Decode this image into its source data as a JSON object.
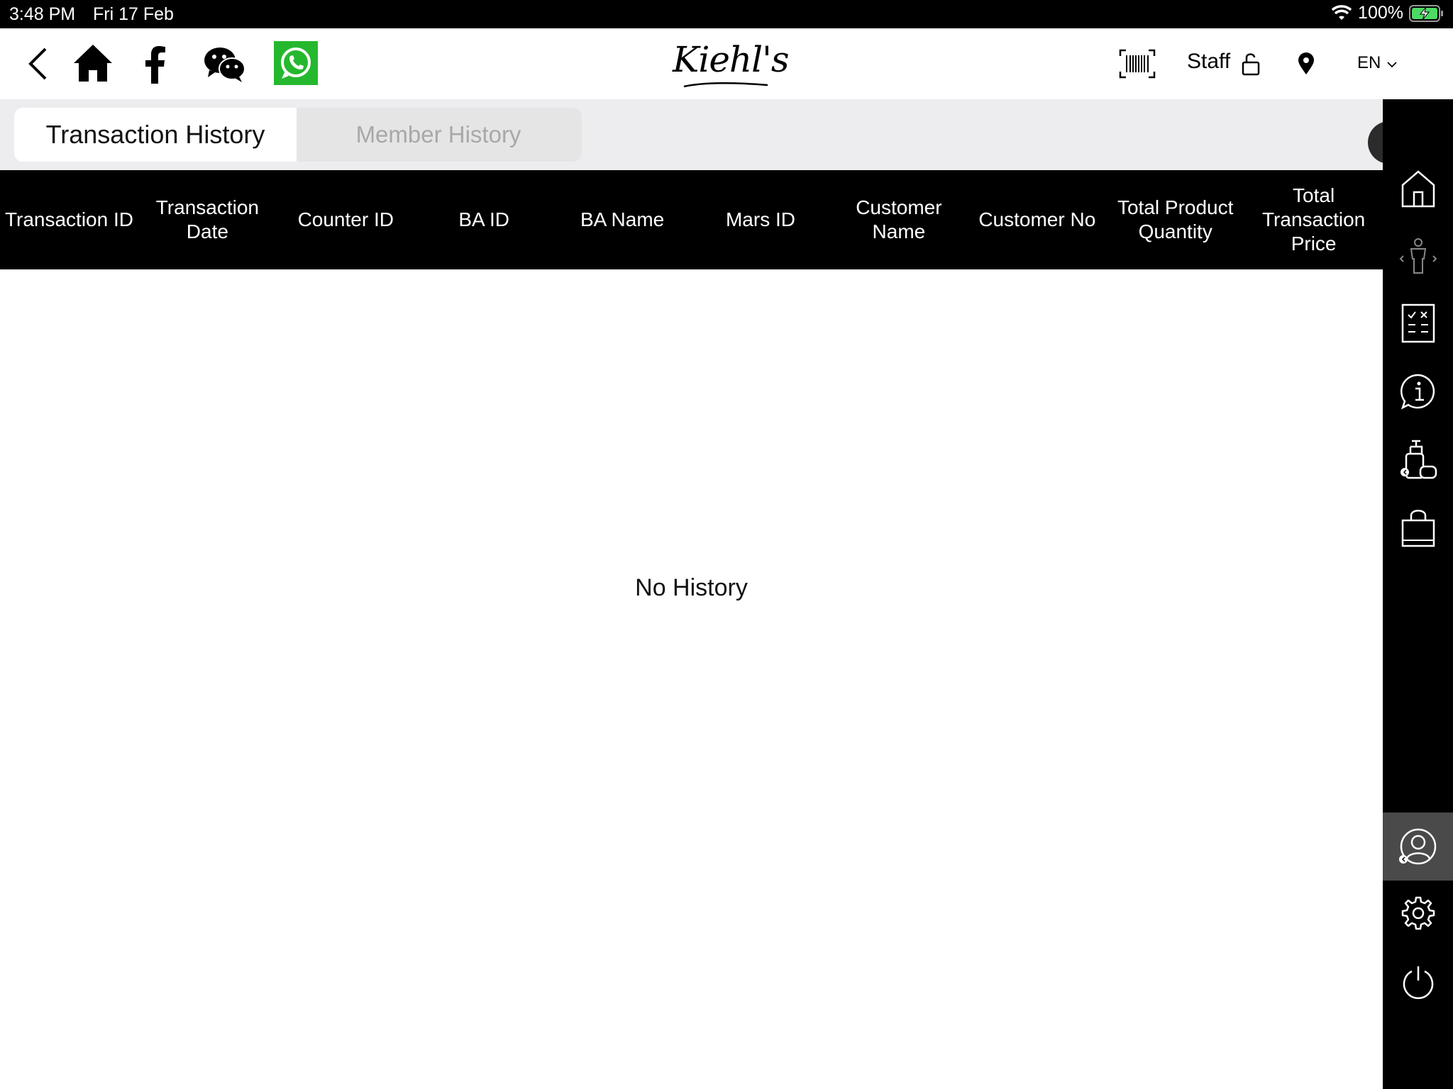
{
  "status_bar": {
    "time": "3:48 PM",
    "date": "Fri 17 Feb",
    "battery": "100%",
    "icons": [
      "wifi-icon",
      "battery-charging-icon"
    ]
  },
  "header": {
    "logo_text": "Kiehl's",
    "staff_label": "Staff",
    "language": "EN",
    "icons": [
      "back-arrow-icon",
      "home-icon",
      "facebook-icon",
      "wechat-icon",
      "whatsapp-icon",
      "barcode-scanner-icon",
      "unlock-icon",
      "location-pin-icon",
      "chevron-down-icon"
    ],
    "whatsapp_color": "#25b82e"
  },
  "tabs": {
    "active": "Transaction History",
    "inactive": "Member History"
  },
  "table": {
    "columns": [
      "Transaction ID",
      "Transaction Date",
      "Counter ID",
      "BA ID",
      "BA Name",
      "Mars ID",
      "Customer Name",
      "Customer No",
      "Total Product Quantity",
      "Total Transaction Price"
    ],
    "rows": [],
    "empty_message": "No History"
  },
  "sidebar": {
    "items": [
      "home-icon",
      "skin-diagnosis-icon",
      "checklist-icon",
      "info-chat-icon",
      "product-consult-icon",
      "shopping-bag-icon",
      "customer-profile-icon",
      "settings-icon",
      "power-icon"
    ],
    "active_item": "customer-profile-icon"
  }
}
